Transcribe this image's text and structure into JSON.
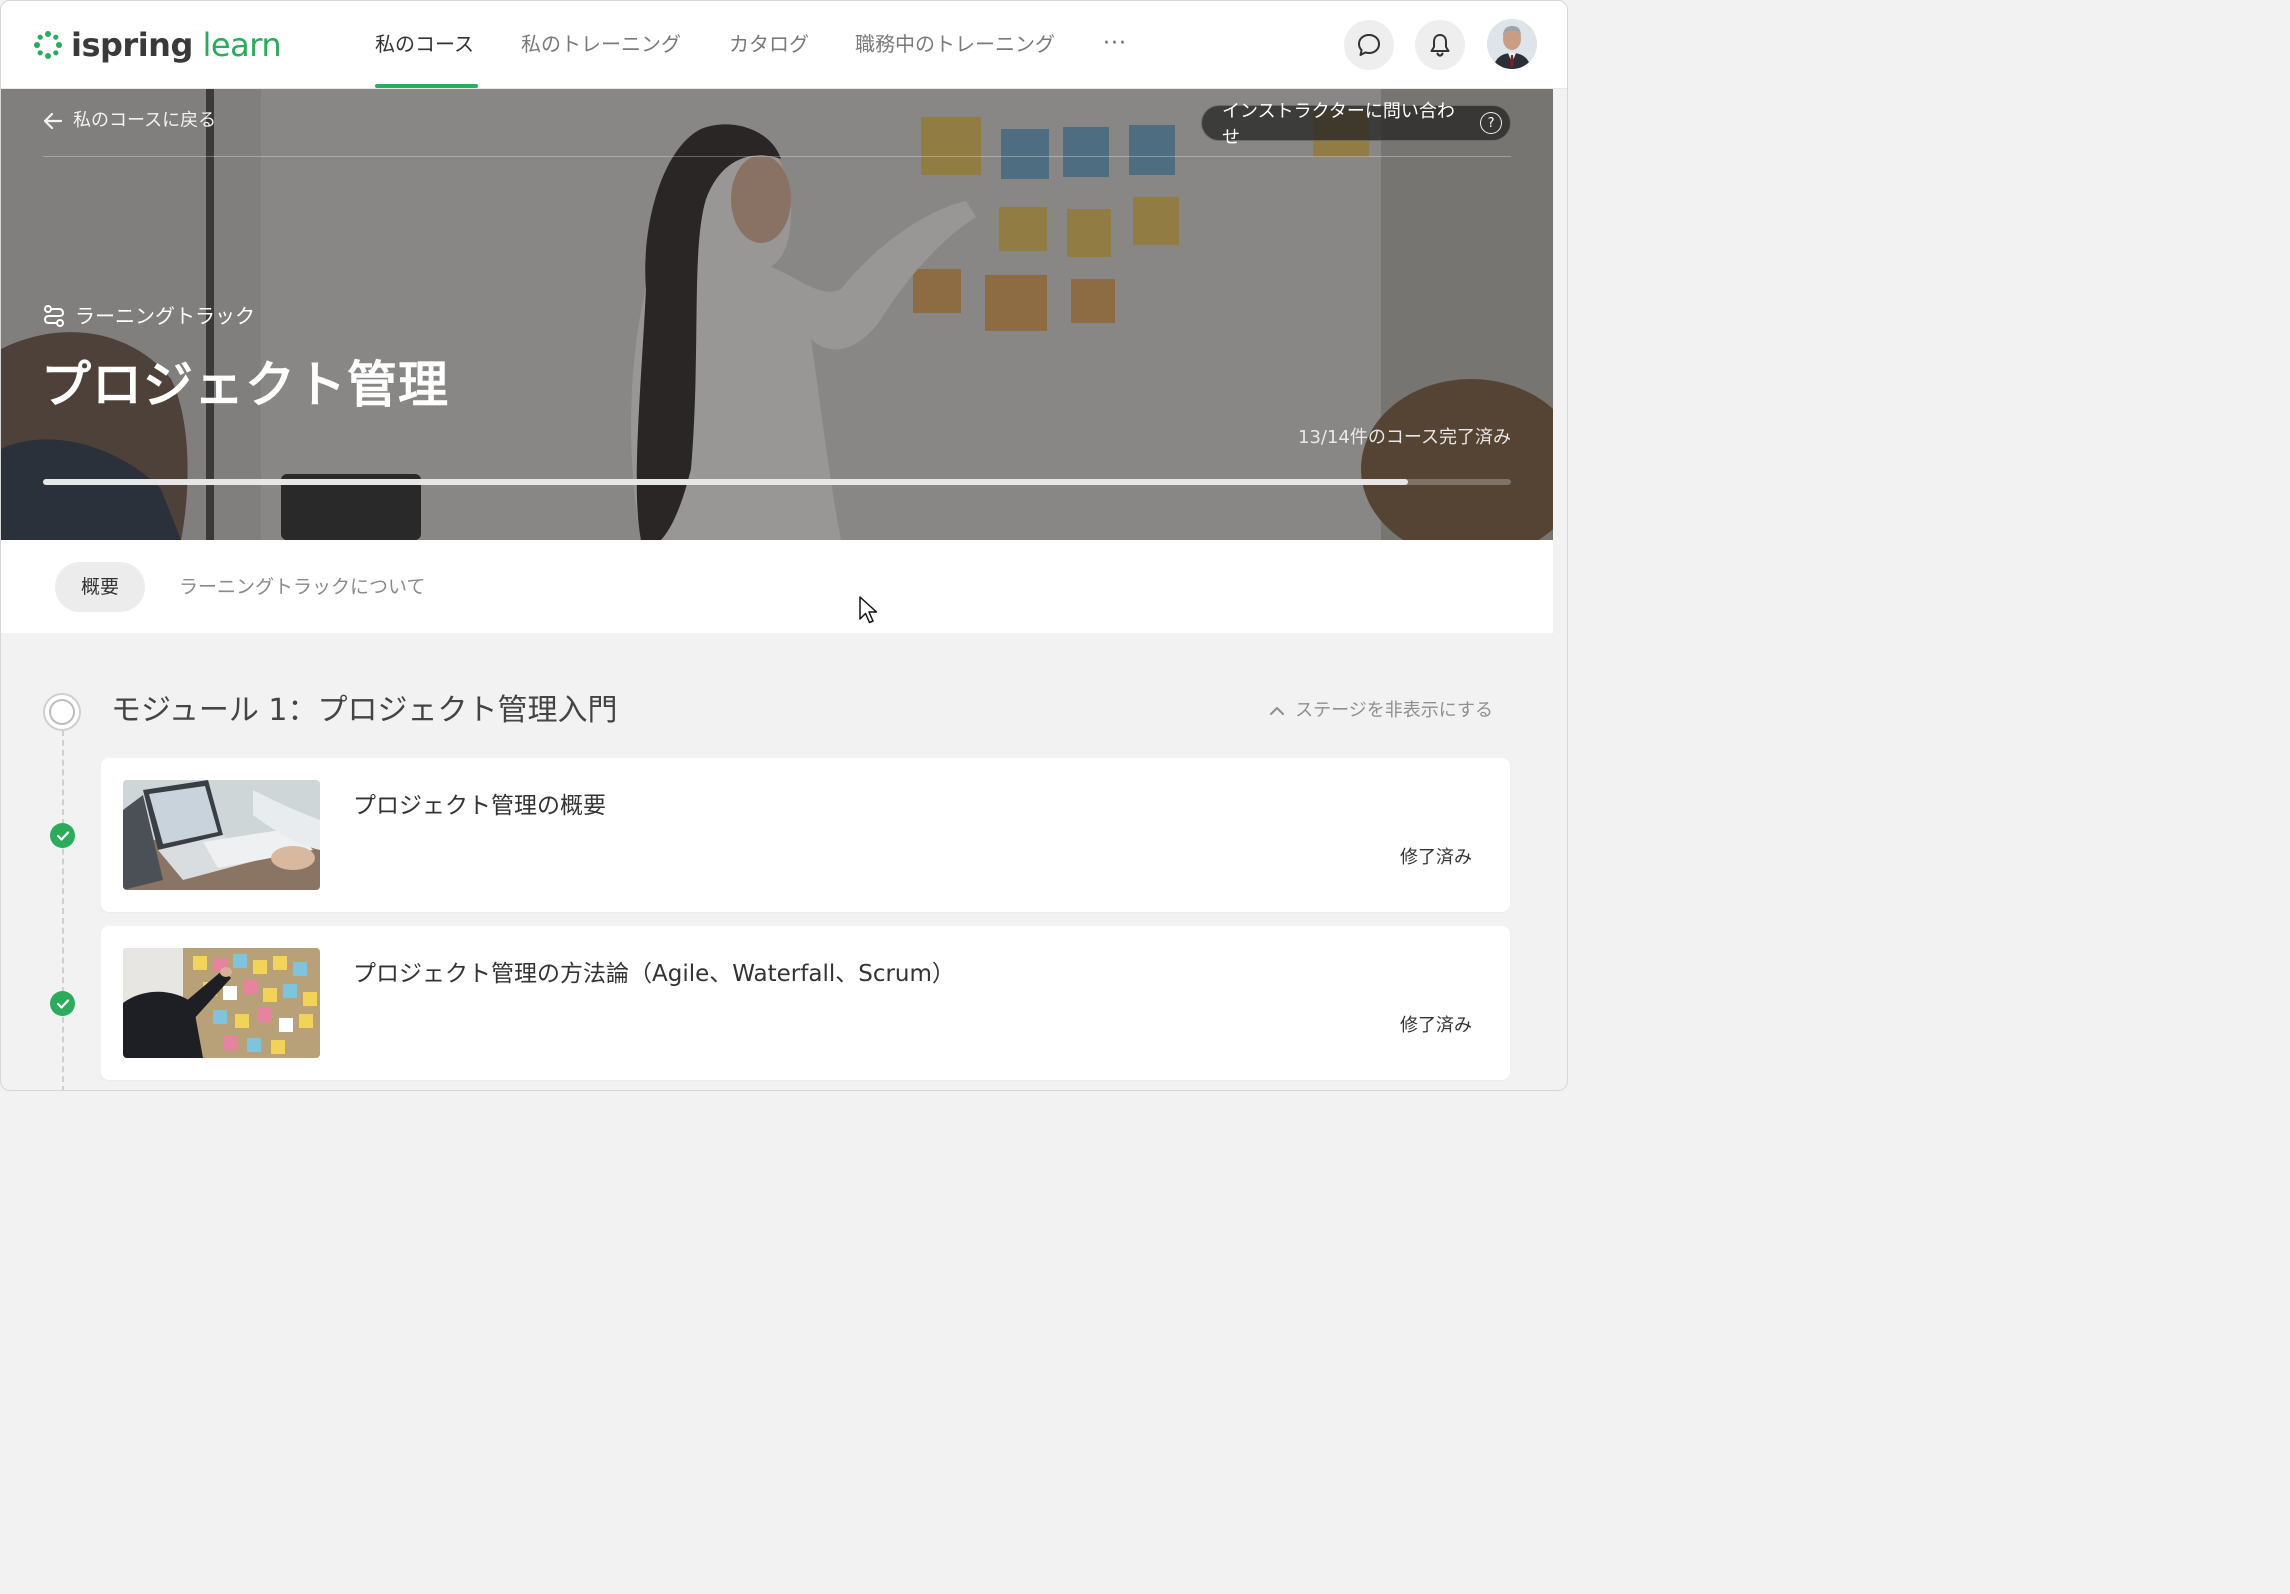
{
  "app": {
    "logo_part1": "ispring",
    "logo_part2": "learn"
  },
  "nav": {
    "items": [
      {
        "label": "私のコース"
      },
      {
        "label": "私のトレーニング"
      },
      {
        "label": "カタログ"
      },
      {
        "label": "職務中のトレーニング"
      }
    ],
    "more_label": "···"
  },
  "hero": {
    "back_label": "私のコースに戻る",
    "contact_label": "インストラクターに問い合わせ",
    "contact_help": "?",
    "track_type_label": "ラーニングトラック",
    "title": "プロジェクト管理",
    "progress_text": "13/14件のコース完了済み",
    "progress_fraction": 0.93
  },
  "tabs": [
    {
      "label": "概要"
    },
    {
      "label": "ラーニングトラックについて"
    }
  ],
  "module": {
    "title": "モジュール 1：プロジェクト管理入門",
    "toggle_label": "ステージを非表示にする",
    "courses": [
      {
        "title": "プロジェクト管理の概要",
        "status": "修了済み"
      },
      {
        "title": "プロジェクト管理の方法論（Agile、Waterfall、Scrum）",
        "status": "修了済み"
      }
    ]
  },
  "colors": {
    "accent": "#2bab5c"
  }
}
